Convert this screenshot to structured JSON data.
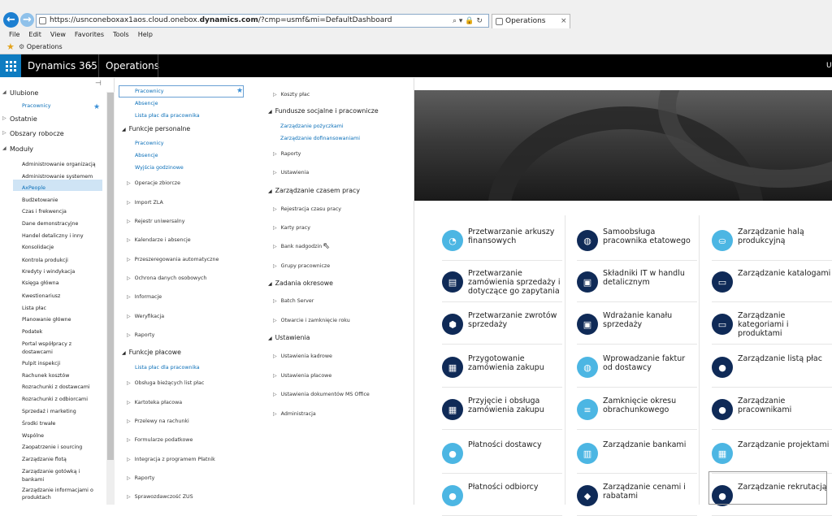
{
  "browser": {
    "url_prefix": "https://usnconeboxax1aos.cloud.onebox.",
    "url_domain": "dynamics.com",
    "url_suffix": "/?cmp=usmf&mi=DefaultDashboard",
    "tab_title": "Operations",
    "tab_close": "×",
    "menu": [
      "File",
      "Edit",
      "View",
      "Favorites",
      "Tools",
      "Help"
    ],
    "favorites_item": "Operations",
    "tools_glyphs": "⌕ ▾ 🔒 ↻"
  },
  "appbar": {
    "brand": "Dynamics 365",
    "brand_chevron": "⌄",
    "module_title": "Operations",
    "user_initial": "U"
  },
  "nav": {
    "pin_glyph": "⊣",
    "sections": {
      "favorites": "Ulubione",
      "recent": "Ostatnie",
      "workspaces": "Obszary robocze",
      "modules": "Moduły"
    },
    "favorites_items": [
      "Pracownicy"
    ],
    "modules": [
      "Administrowanie organizacją",
      "Administrowanie systemem",
      "AxPeople",
      "Budżetowanie",
      "Czas i frekwencja",
      "Dane demonstracyjne",
      "Handel detaliczny i inny",
      "Konsolidacje",
      "Kontrola produkcji",
      "Kredyty i windykacja",
      "Księga główna",
      "Kwestionariusz",
      "Lista płac",
      "Planowanie główne",
      "Podatek",
      "Portal współpracy z",
      "dostawcami",
      "Pulpit inspekcji",
      "Rachunek kosztów",
      "Rozrachunki z dostawcami",
      "Rozrachunki z odbiorcami",
      "Sprzedaż i marketing",
      "Środki trwałe",
      "Wspólne",
      "Zaopatrzenie i sourcing",
      "Zarządzanie flotą",
      "Zarządzanie gotówką i",
      "bankami",
      "Zarządzanie informacjami o",
      "produktach"
    ]
  },
  "flyout": {
    "col1": {
      "top_links": [
        "Pracownicy",
        "Absencje",
        "Lista płac dla pracownika"
      ],
      "h_personal": "Funkcje personalne",
      "personal_links": [
        "Pracownicy",
        "Absencje",
        "Wyjścia godzinowe"
      ],
      "groups_a": [
        "Operacje zbiorcze",
        "Import ZLA",
        "Rejestr uniwersalny",
        "Kalendarze i absencje",
        "Przeszeregowania automatyczne",
        "Ochrona danych osobowych",
        "Informacje",
        "Weryfikacja",
        "Raporty"
      ],
      "h_payroll": "Funkcje płacowe",
      "payroll_links": [
        "Lista płac dla pracownika"
      ],
      "groups_b": [
        "Obsługa bieżących list płac",
        "Kartoteka płacowa",
        "Przelewy na rachunki",
        "Formularze podatkowe",
        "Integracja z programem Płatnik",
        "Raporty",
        "Sprawozdawczość ZUS"
      ]
    },
    "col2": {
      "g_costs": "Koszty płac",
      "h_funds": "Fundusze socjalne i pracownicze",
      "funds_links": [
        "Zarządzanie pożyczkami",
        "Zarządzanie dofinansowaniami"
      ],
      "funds_groups": [
        "Raporty",
        "Ustawienia"
      ],
      "h_time": "Zarządzanie czasem pracy",
      "time_groups": [
        "Rejestracja czasu pracy",
        "Karty pracy",
        "Bank nadgodzin",
        "Grupy pracownicze"
      ],
      "h_periodic": "Zadania okresowe",
      "periodic_groups": [
        "Batch Server",
        "Otwarcie i zamknięcie roku"
      ],
      "h_settings": "Ustawienia",
      "settings_groups": [
        "Ustawienia kadrowe",
        "Ustawienia płacowe",
        "Ustawienia dokumentów MS Office",
        "Administracja"
      ]
    }
  },
  "tiles": [
    [
      "Przetwarzanie arkuszy finansowych",
      "Przetwarzanie zamówienia sprzedaży i dotyczące go zapytania",
      "Przetwarzanie zwrotów sprzedaży",
      "Przygotowanie zamówienia zakupu",
      "Przyjęcie i obsługa zamówienia zakupu",
      "Płatności dostawcy",
      "Płatności odbiorcy"
    ],
    [
      "Samoobsługa pracownika etatowego",
      "Składniki IT w handlu detalicznym",
      "Wdrażanie kanału sprzedaży",
      "Wprowadzanie faktur od dostawcy",
      "Zamknięcie okresu obrachunkowego",
      "Zarządzanie bankami",
      "Zarządzanie cenami i rabatami"
    ],
    [
      "Zarządzanie halą produkcyjną",
      "Zarządzanie katalogami",
      "Zarządzanie kategoriami i produktami",
      "Zarządzanie listą płac",
      "Zarządzanie pracownikami",
      "Zarządzanie projektami",
      "Zarządzanie rekrutacją"
    ]
  ],
  "tile_icons": [
    [
      "chart-icon",
      "document-icon",
      "box-icon",
      "invoice-icon",
      "receipt-icon",
      "people-icon",
      "people-icon"
    ],
    [
      "person-icon",
      "store-icon",
      "store-icon",
      "person-icon",
      "list-icon",
      "bank-icon",
      "tag-icon"
    ],
    [
      "factory-icon",
      "catalog-icon",
      "catalog-icon",
      "people-icon",
      "people-icon",
      "grid-icon",
      "people-icon"
    ]
  ],
  "tile_glyphs": [
    [
      "◔",
      "▤",
      "⬢",
      "▦",
      "▦",
      "●",
      "●"
    ],
    [
      "◍",
      "▣",
      "▣",
      "◍",
      "≡",
      "▥",
      "◆"
    ],
    [
      "⛀",
      "▭",
      "▭",
      "●",
      "●",
      "▦",
      "●"
    ]
  ],
  "tile_styles": [
    [
      "light",
      "dark",
      "dark",
      "dark",
      "dark",
      "light",
      "light"
    ],
    [
      "dark",
      "dark",
      "dark",
      "light",
      "light",
      "light",
      "dark"
    ],
    [
      "light",
      "dark",
      "dark",
      "dark",
      "dark",
      "light",
      "dark"
    ]
  ],
  "colors": {
    "accent": "#0e7cc1",
    "icon_light": "#4cb6e3",
    "icon_dark": "#0f2a57",
    "link": "#0b6fb8",
    "appbar": "#000000"
  }
}
